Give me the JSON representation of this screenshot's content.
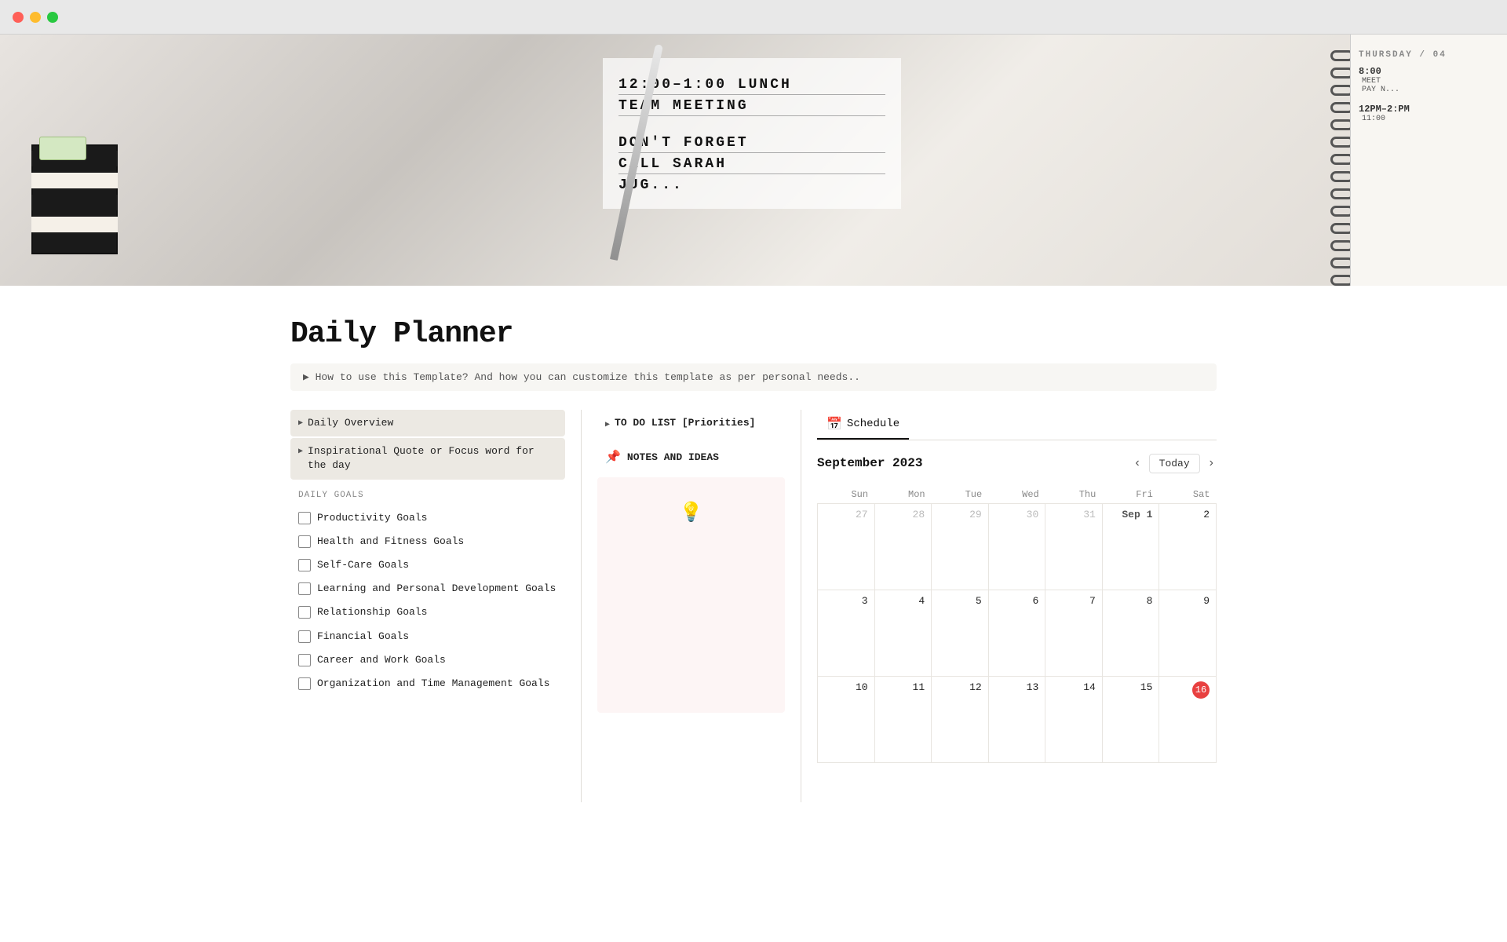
{
  "window": {
    "traffic_lights": [
      "red",
      "yellow",
      "green"
    ]
  },
  "hero": {
    "handwriting_lines": [
      "12:00 - 1:00",
      "LUNCH",
      "TEAM",
      "MEETING",
      "",
      "DON'T FORGET",
      "CALL SARAH",
      "JUG..."
    ],
    "calendar_text": "THURSDAY / 04",
    "time_text": "8:00",
    "pm_text": "12PM - 2:PM",
    "time2": "11:00"
  },
  "page": {
    "title": "Daily Planner",
    "info_text": "▶  How to use this Template? And how you can customize this template as per personal needs..",
    "left_section": {
      "items": [
        {
          "label": "Daily Overview",
          "indent": false
        },
        {
          "label": "Inspirational Quote or Focus word for the day",
          "indent": false
        }
      ],
      "daily_goals_header": "DAILY GOALS",
      "goals": [
        {
          "label": "Productivity Goals",
          "checked": false
        },
        {
          "label": "Health and Fitness Goals",
          "checked": false
        },
        {
          "label": "Self-Care Goals",
          "checked": false
        },
        {
          "label": "Learning and Personal Development Goals",
          "checked": false
        },
        {
          "label": "Relationship Goals",
          "checked": false
        },
        {
          "label": "Financial Goals",
          "checked": false
        },
        {
          "label": "Career and Work Goals",
          "checked": false
        },
        {
          "label": "Organization and Time Management Goals",
          "checked": false
        }
      ]
    },
    "middle_section": {
      "todo_label": "TO DO LIST [Priorities]",
      "notes_label": "NOTES AND IDEAS",
      "notes_icon": "📌",
      "bulb_icon": "💡"
    },
    "calendar": {
      "tab_label": "Schedule",
      "tab_icon": "📅",
      "month_year": "September 2023",
      "nav_today": "Today",
      "day_headers": [
        "Sun",
        "Mon",
        "Tue",
        "Wed",
        "Thu",
        "Fri",
        "Sat"
      ],
      "weeks": [
        [
          {
            "date": "27",
            "type": "other-month"
          },
          {
            "date": "28",
            "type": "other-month"
          },
          {
            "date": "29",
            "type": "other-month"
          },
          {
            "date": "30",
            "type": "other-month"
          },
          {
            "date": "31",
            "type": "other-month"
          },
          {
            "date": "Sep 1",
            "type": "current-month sep1"
          },
          {
            "date": "2",
            "type": "current-month"
          }
        ],
        [
          {
            "date": "3",
            "type": "current-month"
          },
          {
            "date": "4",
            "type": "current-month"
          },
          {
            "date": "5",
            "type": "current-month"
          },
          {
            "date": "6",
            "type": "current-month"
          },
          {
            "date": "7",
            "type": "current-month"
          },
          {
            "date": "8",
            "type": "current-month"
          },
          {
            "date": "9",
            "type": "current-month"
          }
        ],
        [
          {
            "date": "10",
            "type": "current-month"
          },
          {
            "date": "11",
            "type": "current-month"
          },
          {
            "date": "12",
            "type": "current-month"
          },
          {
            "date": "13",
            "type": "current-month"
          },
          {
            "date": "14",
            "type": "current-month"
          },
          {
            "date": "15",
            "type": "current-month"
          },
          {
            "date": "16",
            "type": "current-month today"
          }
        ]
      ]
    }
  }
}
